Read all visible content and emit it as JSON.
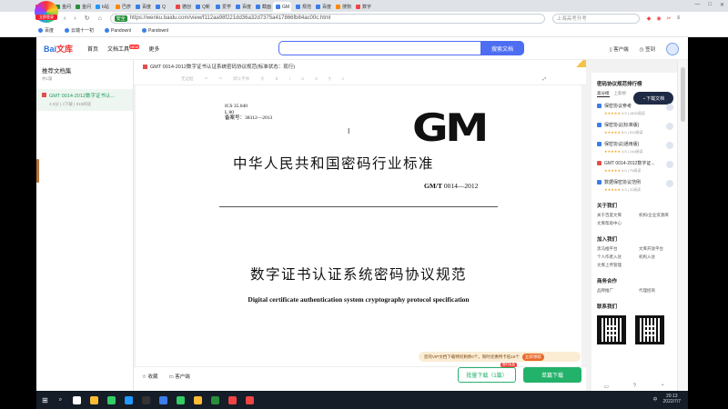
{
  "browser": {
    "logo_label": "立即登录",
    "tabs": [
      {
        "label": "360",
        "color": "#e44"
      },
      {
        "label": "金问",
        "color": "#2a8f3a"
      },
      {
        "label": "金问",
        "color": "#2a8f3a"
      },
      {
        "label": "b站",
        "color": "#29f"
      },
      {
        "label": "巴彦",
        "color": "#f80"
      },
      {
        "label": "百度",
        "color": "#3b7de9"
      },
      {
        "label": "Q",
        "color": "#3b7de9"
      },
      {
        "label": "德创",
        "color": "#e44"
      },
      {
        "label": "Q新",
        "color": "#3b7de9"
      },
      {
        "label": "爱学",
        "color": "#3b7de9"
      },
      {
        "label": "百度",
        "color": "#3b7de9"
      },
      {
        "label": "截面",
        "color": "#3b7de9"
      },
      {
        "label": "GM",
        "color": "#3b7de9"
      },
      {
        "label": "规范",
        "color": "#3b7de9"
      },
      {
        "label": "百度",
        "color": "#3b7de9"
      },
      {
        "label": "搜狗",
        "color": "#f80"
      },
      {
        "label": "数字",
        "color": "#e44"
      }
    ],
    "url": "https://wenku.baidu.com/view/f112aa98f221dd36a32d7375a417866fb84ac00c.html",
    "secure_label": "安全",
    "side_search_placeholder": "上海高考开考",
    "bookmarks": [
      "百度",
      "云端十一初",
      "Pandownl",
      "Pandownl"
    ]
  },
  "header": {
    "logo_text": "Bai",
    "logo_sub": "文库",
    "nav": [
      "首页",
      "文档工具",
      "更多"
    ],
    "new_badge": "NEW",
    "search_button": "搜索文档",
    "client_label": "客户端",
    "sign_label": "签到"
  },
  "sidebar": {
    "title": "推荐文档集",
    "count": "共1篇",
    "item_title": "GMT 0014-2012数字证书认...",
    "item_meta": "4.0分 | 4下载 | 919阅读"
  },
  "document": {
    "title": "GMT 0014-2012数字证书认证系统密码协议规范(标准状态：现行)",
    "toolbar": [
      "无边框",
      "↶",
      "↷",
      "默认字体",
      "大",
      "B",
      "I",
      "U",
      "S",
      "¶",
      "≡"
    ],
    "ics_lines": [
      "ICS 35.040",
      "L 80",
      "备案号：38312—2013"
    ],
    "logo": "GM",
    "standard_heading": "中华人民共和国密码行业标准",
    "standard_no_prefix": "GM/T",
    "standard_no": " 0014—2012",
    "main_title": "数字证书认证系统密码协议规范",
    "english_title": "Digital certificate authentication system cryptography protocol specification",
    "cursor": "I"
  },
  "vip_banner": {
    "text": "您的VIP文档下载特权剩余0个，限时优惠特卡低16个",
    "button": "立即领取"
  },
  "bottom_bar": {
    "favorite": "收藏",
    "client": "客户端",
    "batch_download": "批量下载（1篇）",
    "batch_tag": "限时免费",
    "single_download": "单篇下载"
  },
  "right_panel": {
    "ranking_title": "密码协议规范排行榜",
    "tabs": [
      "高分榜",
      "上新榜"
    ],
    "download_badge": "下载文档",
    "items": [
      {
        "title": "保密协议参考",
        "score": "4.9",
        "reads": "1832阅读",
        "color": "#3b7de9"
      },
      {
        "title": "保密协议(标准版)",
        "score": "5.0",
        "reads": "510阅读",
        "color": "#3b7de9"
      },
      {
        "title": "保密协议(通用版)",
        "score": "4.5",
        "reads": "144阅读",
        "color": "#3b7de9"
      },
      {
        "title": "GMT 0014-2012数字证...",
        "score": "4.0",
        "reads": "70阅读",
        "color": "#e24d4d"
      },
      {
        "title": "数据保密协议范例",
        "score": "4.3",
        "reads": "11阅读",
        "color": "#3b7de9"
      }
    ],
    "about_title": "关于我们",
    "about_rows": [
      [
        "关于百度文库",
        "机构/企业资源库"
      ],
      [
        "文库帮助中心",
        ""
      ]
    ],
    "join_title": "加入我们",
    "join_rows": [
      [
        "黑马推平台",
        "文库开放平台"
      ],
      [
        "个人作者入驻",
        "机构入驻"
      ],
      [
        "文库上传管理",
        ""
      ]
    ],
    "biz_title": "商务合作",
    "biz_rows": [
      [
        "品牌推广",
        "代理招商"
      ]
    ],
    "contact_title": "联系我们",
    "bottom_icons": [
      "▭",
      "?",
      "⌃"
    ]
  },
  "taskbar": {
    "time": "20:13",
    "date": "2022/7/7",
    "lang": "中",
    "icons": [
      {
        "color": "#fff"
      },
      {
        "color": "#fb3"
      },
      {
        "color": "#3c6"
      },
      {
        "color": "#29f"
      },
      {
        "color": "#333"
      },
      {
        "color": "#3b7de9"
      },
      {
        "color": "#3c6"
      },
      {
        "color": "#fb3"
      },
      {
        "color": "#2a8f3a"
      },
      {
        "color": "#e44"
      },
      {
        "color": "#e44"
      }
    ]
  }
}
